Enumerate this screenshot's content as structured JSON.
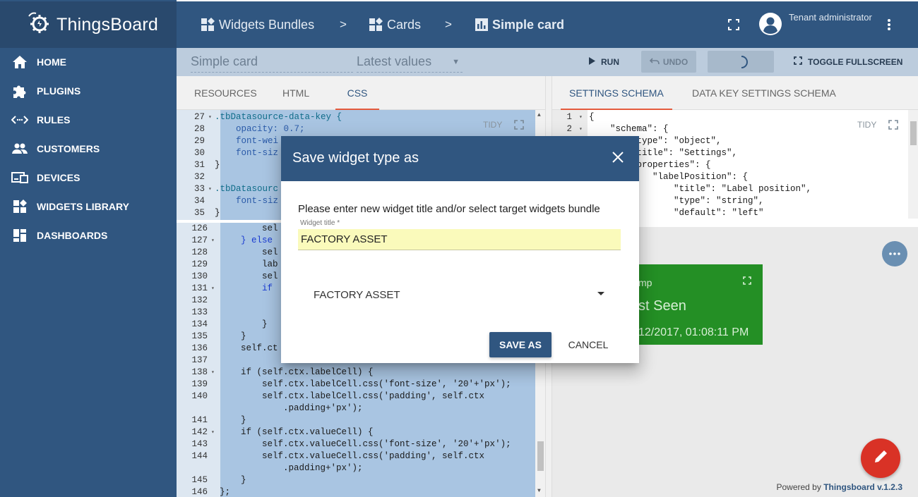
{
  "app": {
    "name": "ThingsBoard"
  },
  "sidebar": {
    "items": [
      {
        "label": "HOME",
        "icon": "home-icon"
      },
      {
        "label": "PLUGINS",
        "icon": "puzzle-icon"
      },
      {
        "label": "RULES",
        "icon": "code-arrows-icon"
      },
      {
        "label": "CUSTOMERS",
        "icon": "people-icon"
      },
      {
        "label": "DEVICES",
        "icon": "devices-icon"
      },
      {
        "label": "WIDGETS LIBRARY",
        "icon": "widgets-icon"
      },
      {
        "label": "DASHBOARDS",
        "icon": "dashboard-icon"
      }
    ]
  },
  "header": {
    "breadcrumbs": [
      "Widgets Bundles",
      "Cards",
      "Simple card"
    ],
    "separator": ">",
    "user": "Tenant administrator"
  },
  "toolbar": {
    "widget_name": "Simple card",
    "widget_type": "Latest values",
    "run": "RUN",
    "undo": "UNDO",
    "fullscreen": "TOGGLE FULLSCREEN"
  },
  "left_tabs": [
    "RESOURCES",
    "HTML",
    "CSS"
  ],
  "right_tabs": [
    "SETTINGS SCHEMA",
    "DATA KEY SETTINGS SCHEMA"
  ],
  "tidy": "TIDY",
  "css_editor": {
    "lines": [
      {
        "n": "27",
        "fold": true,
        "text": ".tbDatasource-data-key {",
        "cls": "c-sel"
      },
      {
        "n": "28",
        "fold": false,
        "text": "    opacity: 0.7;",
        "cls": "c-prop"
      },
      {
        "n": "29",
        "fold": false,
        "text": "    font-wei",
        "cls": "c-prop"
      },
      {
        "n": "30",
        "fold": false,
        "text": "    font-siz",
        "cls": "c-prop"
      },
      {
        "n": "31",
        "fold": false,
        "text": "}",
        "cls": "c-plain"
      },
      {
        "n": "32",
        "fold": false,
        "text": "",
        "cls": "c-plain"
      },
      {
        "n": "33",
        "fold": true,
        "text": ".tbDatasourc",
        "cls": "c-sel"
      },
      {
        "n": "34",
        "fold": false,
        "text": "    font-siz",
        "cls": "c-prop"
      },
      {
        "n": "35",
        "fold": false,
        "text": "}",
        "cls": "c-plain"
      }
    ]
  },
  "js_editor": {
    "lines": [
      {
        "n": "126",
        "fold": false,
        "text": "        sel",
        "cls": "c-plain"
      },
      {
        "n": "127",
        "fold": true,
        "text": "    } else",
        "cls": "c-kw"
      },
      {
        "n": "128",
        "fold": false,
        "text": "        sel",
        "cls": "c-plain"
      },
      {
        "n": "129",
        "fold": false,
        "text": "        lab",
        "cls": "c-plain"
      },
      {
        "n": "130",
        "fold": false,
        "text": "        sel",
        "cls": "c-plain"
      },
      {
        "n": "131",
        "fold": true,
        "text": "        if",
        "cls": "c-kw"
      },
      {
        "n": "132",
        "fold": false,
        "text": "",
        "cls": "c-plain"
      },
      {
        "n": "133",
        "fold": false,
        "text": "",
        "cls": "c-plain"
      },
      {
        "n": "134",
        "fold": false,
        "text": "        }",
        "cls": "c-plain"
      },
      {
        "n": "135",
        "fold": false,
        "text": "    }",
        "cls": "c-plain"
      },
      {
        "n": "136",
        "fold": false,
        "text": "    self.ct",
        "cls": "c-plain"
      },
      {
        "n": "137",
        "fold": false,
        "text": "",
        "cls": "c-plain"
      },
      {
        "n": "138",
        "fold": true,
        "text": "    if (self.ctx.labelCell) {",
        "cls": "c-plain"
      },
      {
        "n": "139",
        "fold": false,
        "text": "        self.ctx.labelCell.css('font-size', '20'+'px');",
        "cls": "c-plain"
      },
      {
        "n": "140",
        "fold": false,
        "text": "        self.ctx.labelCell.css('padding', self.ctx",
        "cls": "c-plain"
      },
      {
        "n": "",
        "fold": false,
        "text": "            .padding+'px');",
        "cls": "c-plain"
      },
      {
        "n": "141",
        "fold": false,
        "text": "    }",
        "cls": "c-plain"
      },
      {
        "n": "142",
        "fold": true,
        "text": "    if (self.ctx.valueCell) {",
        "cls": "c-plain"
      },
      {
        "n": "143",
        "fold": false,
        "text": "        self.ctx.valueCell.css('font-size', '20'+'px');",
        "cls": "c-plain"
      },
      {
        "n": "144",
        "fold": false,
        "text": "        self.ctx.valueCell.css('padding', self.ctx",
        "cls": "c-plain"
      },
      {
        "n": "",
        "fold": false,
        "text": "            .padding+'px');",
        "cls": "c-plain"
      },
      {
        "n": "145",
        "fold": false,
        "text": "    }",
        "cls": "c-plain"
      },
      {
        "n": "146",
        "fold": false,
        "text": "};",
        "cls": "c-plain"
      }
    ]
  },
  "schema_editor": {
    "lines": [
      {
        "n": "1",
        "fold": true,
        "text": "{"
      },
      {
        "n": "2",
        "fold": true,
        "text": "    \"schema\": {"
      },
      {
        "n": "",
        "fold": false,
        "text": "        \"type\": \"object\","
      },
      {
        "n": "",
        "fold": false,
        "text": "        \"title\": \"Settings\","
      },
      {
        "n": "",
        "fold": false,
        "text": "        \"properties\": {"
      },
      {
        "n": "",
        "fold": false,
        "text": "            \"labelPosition\": {"
      },
      {
        "n": "",
        "fold": false,
        "text": "                \"title\": \"Label position\","
      },
      {
        "n": "",
        "fold": false,
        "text": "                \"type\": \"string\","
      },
      {
        "n": "",
        "fold": false,
        "text": "                \"default\": \"left\""
      }
    ]
  },
  "preview_card": {
    "title": "mp",
    "label": "st Seen",
    "value": "12/2017, 01:08:11 PM"
  },
  "powered_by": {
    "prefix": "Powered by",
    "brand": "Thingsboard v.1.2.3"
  },
  "dialog": {
    "title": "Save widget type as",
    "prompt": "Please enter new widget title and/or select target widgets bundle",
    "title_field_label": "Widget title *",
    "title_value": "FACTORY ASSET",
    "bundle_value": "FACTORY ASSET",
    "save_label": "SAVE AS",
    "cancel_label": "CANCEL"
  }
}
